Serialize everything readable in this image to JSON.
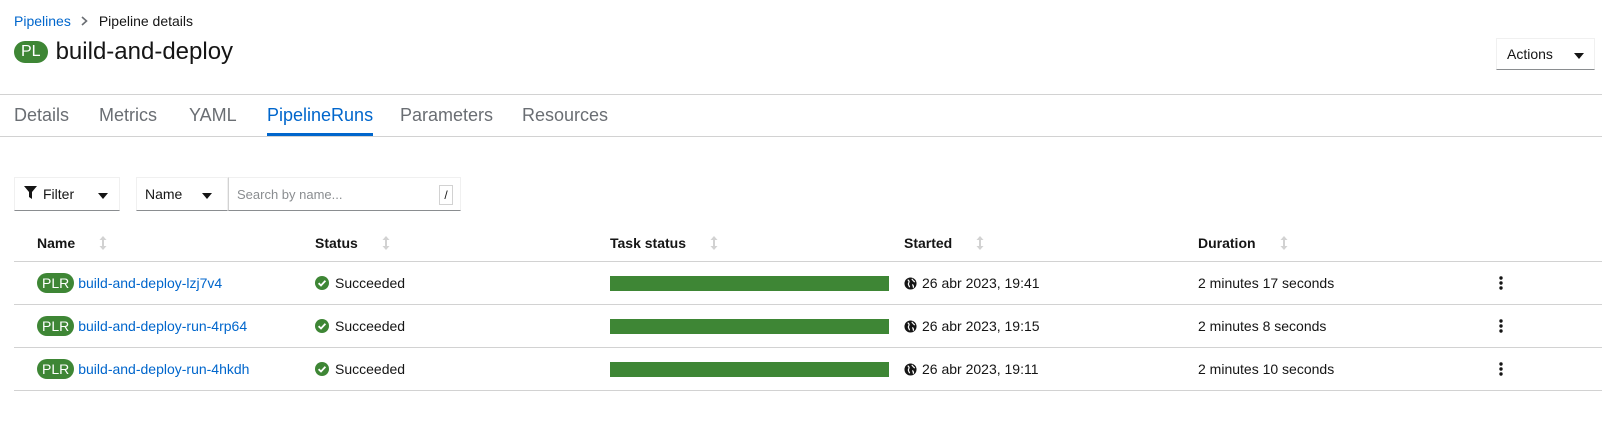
{
  "breadcrumb": {
    "root": "Pipelines",
    "current": "Pipeline details"
  },
  "header": {
    "badge": "PL",
    "title": "build-and-deploy",
    "actions_label": "Actions"
  },
  "tabs": [
    {
      "label": "Details"
    },
    {
      "label": "Metrics"
    },
    {
      "label": "YAML"
    },
    {
      "label": "PipelineRuns",
      "active": true
    },
    {
      "label": "Parameters"
    },
    {
      "label": "Resources"
    }
  ],
  "toolbar": {
    "filter_label": "Filter",
    "name_select": "Name",
    "search_placeholder": "Search by name...",
    "shortcut_key": "/"
  },
  "table": {
    "columns": [
      "Name",
      "Status",
      "Task status",
      "Started",
      "Duration"
    ],
    "rows": [
      {
        "badge": "PLR",
        "name": "build-and-deploy-lzj7v4",
        "status": "Succeeded",
        "task_progress": 1.0,
        "started": "26 abr 2023, 19:41",
        "duration": "2 minutes 17 seconds"
      },
      {
        "badge": "PLR",
        "name": "build-and-deploy-run-4rp64",
        "status": "Succeeded",
        "task_progress": 1.0,
        "started": "26 abr 2023, 19:15",
        "duration": "2 minutes 8 seconds"
      },
      {
        "badge": "PLR",
        "name": "build-and-deploy-run-4hkdh",
        "status": "Succeeded",
        "task_progress": 1.0,
        "started": "26 abr 2023, 19:11",
        "duration": "2 minutes 10 seconds"
      }
    ]
  },
  "colors": {
    "accent": "#0066cc",
    "success": "#3e8635",
    "muted": "#6a6e73"
  }
}
